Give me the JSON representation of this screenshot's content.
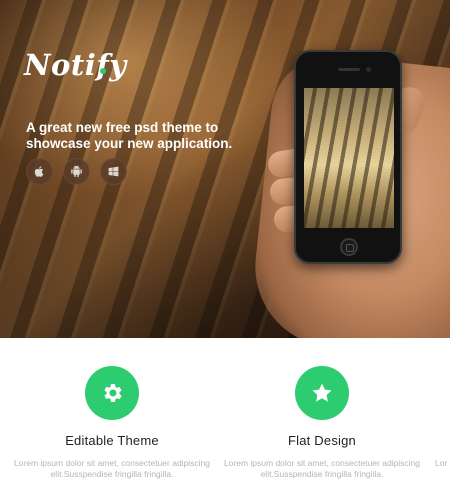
{
  "hero": {
    "logo_text": "Notify",
    "tagline": "A great new free psd theme to showcase your new application.",
    "platforms": [
      {
        "name": "apple",
        "icon": "apple-icon"
      },
      {
        "name": "android",
        "icon": "android-icon"
      },
      {
        "name": "windows",
        "icon": "windows-icon"
      }
    ]
  },
  "features": [
    {
      "icon": "gear-icon",
      "title": "Editable Theme",
      "description": "Lorem ipsum dolor sit amet, consectetuer adipiscing elit.Susspendise fringilla fringilla."
    },
    {
      "icon": "star-icon",
      "title": "Flat Design",
      "description": "Lorem ipsum dolor sit amet, consectetuer adipiscing elit.Susspendise fringilla fringilla."
    },
    {
      "icon": "",
      "title": "",
      "description": "Lor"
    }
  ],
  "colors": {
    "accent": "#2ecc71",
    "title_text": "#222222",
    "description_text": "#b5b5b5"
  }
}
